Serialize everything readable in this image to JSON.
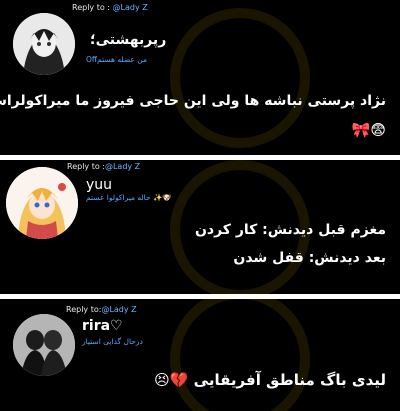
{
  "posts": [
    {
      "reply_prefix": "Reply to : ",
      "reply_to": "@Lady Z",
      "username": "رپربهشتی؛",
      "status": "Offمن عضله هستم",
      "message_lines": [
        "نژاد پرستی نباشه ها ولی این حاجی فیروز ما میراکولراس",
        "😨🎀"
      ]
    },
    {
      "reply_prefix": "Reply to :",
      "reply_to": "@Lady Z",
      "username": "yuu",
      "status": "حاله میراکولوا عستم ✨🐶",
      "message_lines": [
        "مغزم قبل دیدنش: کار کردن",
        "بعد دیدنش: قفل شدن"
      ]
    },
    {
      "reply_prefix": "Reply to:",
      "reply_to": "@Lady Z",
      "username": "rira♡",
      "status": "درحال گدایی استیار",
      "message_lines": [
        "لیدی باگ مناطق آفریقایی 💔😣"
      ]
    }
  ]
}
